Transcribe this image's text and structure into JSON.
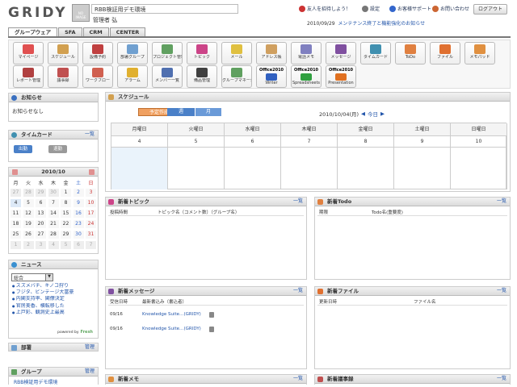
{
  "header": {
    "logo": "GRIDY",
    "noimage": "NO IMAGE",
    "org": "RBB検証用デモ環境",
    "user": "管理者 弘",
    "links": [
      {
        "label": "友人を招待しよう！",
        "color": "#cc3333"
      },
      {
        "label": "設定",
        "color": "#777777"
      },
      {
        "label": "お客様サポート",
        "color": "#3366cc"
      },
      {
        "label": "お問い合わせ",
        "color": "#cc6633"
      }
    ],
    "logout": "ログアウト",
    "notice_date": "2010/09/29",
    "notice_text": "メンテナンス終了と機能強化のお知らせ"
  },
  "tabs": [
    "グループウェア",
    "SFA",
    "CRM",
    "CENTER"
  ],
  "apps_row1": [
    {
      "label": "マイページ",
      "color": "#e05050",
      "icon": "mypage-icon"
    },
    {
      "label": "スケジュール",
      "color": "#d2a050",
      "icon": "schedule-icon"
    },
    {
      "label": "設備予約",
      "color": "#c04040",
      "icon": "facility-icon"
    },
    {
      "label": "部署グループ",
      "color": "#70a0d0",
      "icon": "department-icon"
    },
    {
      "label": "プロジェクト管理",
      "color": "#60a060",
      "icon": "project-icon"
    },
    {
      "label": "トピック",
      "color": "#cc4488",
      "icon": "topic-icon"
    },
    {
      "label": "メール",
      "color": "#e0c040",
      "icon": "mail-icon"
    },
    {
      "label": "アドレス帳",
      "color": "#d0a060",
      "icon": "address-book-icon"
    },
    {
      "label": "電話メモ",
      "color": "#8080c0",
      "icon": "phone-memo-icon"
    },
    {
      "label": "メッセージ",
      "color": "#8050a0",
      "icon": "message-icon"
    },
    {
      "label": "タイムカード",
      "color": "#4090b0",
      "icon": "timecard-icon"
    },
    {
      "label": "ToDo",
      "color": "#e08040",
      "icon": "todo-icon"
    },
    {
      "label": "ファイル",
      "color": "#e07030",
      "icon": "file-icon"
    },
    {
      "label": "メモパッド",
      "color": "#e09040",
      "icon": "memopad-icon"
    }
  ],
  "apps_row2": [
    {
      "label": "レポート管理",
      "color": "#b04040",
      "icon": "report-icon"
    },
    {
      "label": "議事録",
      "color": "#c05050",
      "icon": "minutes-icon"
    },
    {
      "label": "ワークフロー",
      "color": "#d06050",
      "icon": "workflow-icon"
    },
    {
      "label": "アラーム",
      "color": "#e0b030",
      "icon": "alarm-icon"
    },
    {
      "label": "メンバー一覧",
      "color": "#5070b0",
      "icon": "members-icon"
    },
    {
      "label": "備品管理",
      "color": "#404040",
      "icon": "equipment-icon"
    },
    {
      "label": "グループマネージャー",
      "color": "#60a060",
      "icon": "group-manager-icon"
    },
    {
      "label": "Writer",
      "office": "Office2010",
      "color": "#3060c0",
      "icon": "writer-icon"
    },
    {
      "label": "Spreadsheets",
      "office": "Office2010",
      "color": "#30a040",
      "icon": "spreadsheets-icon"
    },
    {
      "label": "Presentation",
      "office": "Office2010",
      "color": "#e07020",
      "icon": "presentation-icon"
    }
  ],
  "sidebar": {
    "notice": {
      "title": "お知らせ",
      "body": "お知らせなし"
    },
    "timecard": {
      "title": "タイムカード",
      "more": "一覧",
      "in": "出勤",
      "out": "退勤"
    },
    "calendar": {
      "month": "2010/10",
      "weekdays": [
        "月",
        "火",
        "水",
        "木",
        "金",
        "土",
        "日"
      ],
      "rows": [
        [
          "27",
          "28",
          "29",
          "30",
          "1",
          "2",
          "3"
        ],
        [
          "4",
          "5",
          "6",
          "7",
          "8",
          "9",
          "10"
        ],
        [
          "11",
          "12",
          "13",
          "14",
          "15",
          "16",
          "17"
        ],
        [
          "18",
          "19",
          "20",
          "21",
          "22",
          "23",
          "24"
        ],
        [
          "25",
          "26",
          "27",
          "28",
          "29",
          "30",
          "31"
        ],
        [
          "1",
          "2",
          "3",
          "4",
          "5",
          "6",
          "7"
        ]
      ]
    },
    "news": {
      "title": "ニュース",
      "select": "総合",
      "items": [
        "スズメバチ、キノコ狩り",
        "フジタ、ビンテージ大富豪",
        "内閣支持率、閣僚決定",
        "官房美香、横転移した",
        "上戸彩、観測史上最高"
      ],
      "powered": "powered by",
      "brand": "Fresh"
    },
    "dept": {
      "title": "部署",
      "more": "管理"
    },
    "group": {
      "title": "グループ",
      "more": "管理",
      "item": "RBB検証用デモ環境"
    }
  },
  "schedule": {
    "title": "スケジュール",
    "add": "予定作成",
    "week": "週",
    "month": "月",
    "date": "2010/10/04(月)",
    "today": "今日",
    "days": [
      "月曜日",
      "火曜日",
      "水曜日",
      "木曜日",
      "金曜日",
      "土曜日",
      "日曜日"
    ],
    "dates": [
      "4",
      "5",
      "6",
      "7",
      "8",
      "9",
      "10"
    ]
  },
  "topics": {
    "title": "新着トピック",
    "more": "一覧",
    "col1": "投稿時間",
    "col2": "トピック名（コメント数）（グループ名）"
  },
  "todo": {
    "title": "新着Todo",
    "more": "一覧",
    "col1": "期限",
    "col2": "Todo名(重要度)"
  },
  "messages": {
    "title": "新着メッセージ",
    "more": "一覧",
    "col1": "受信日時",
    "col2": "最新書込み（書込者）",
    "rows": [
      {
        "date": "09/16",
        "text": "Knowledge Suite…(GRIDY)"
      },
      {
        "date": "09/16",
        "text": "Knowledge Suite…(GRIDY)"
      }
    ]
  },
  "files": {
    "title": "新着ファイル",
    "more": "一覧",
    "col1": "更新日時",
    "col2": "ファイル名"
  },
  "memos": {
    "title": "新着メモ",
    "more": "一覧"
  },
  "minutes": {
    "title": "新着議事録",
    "more": "一覧"
  }
}
